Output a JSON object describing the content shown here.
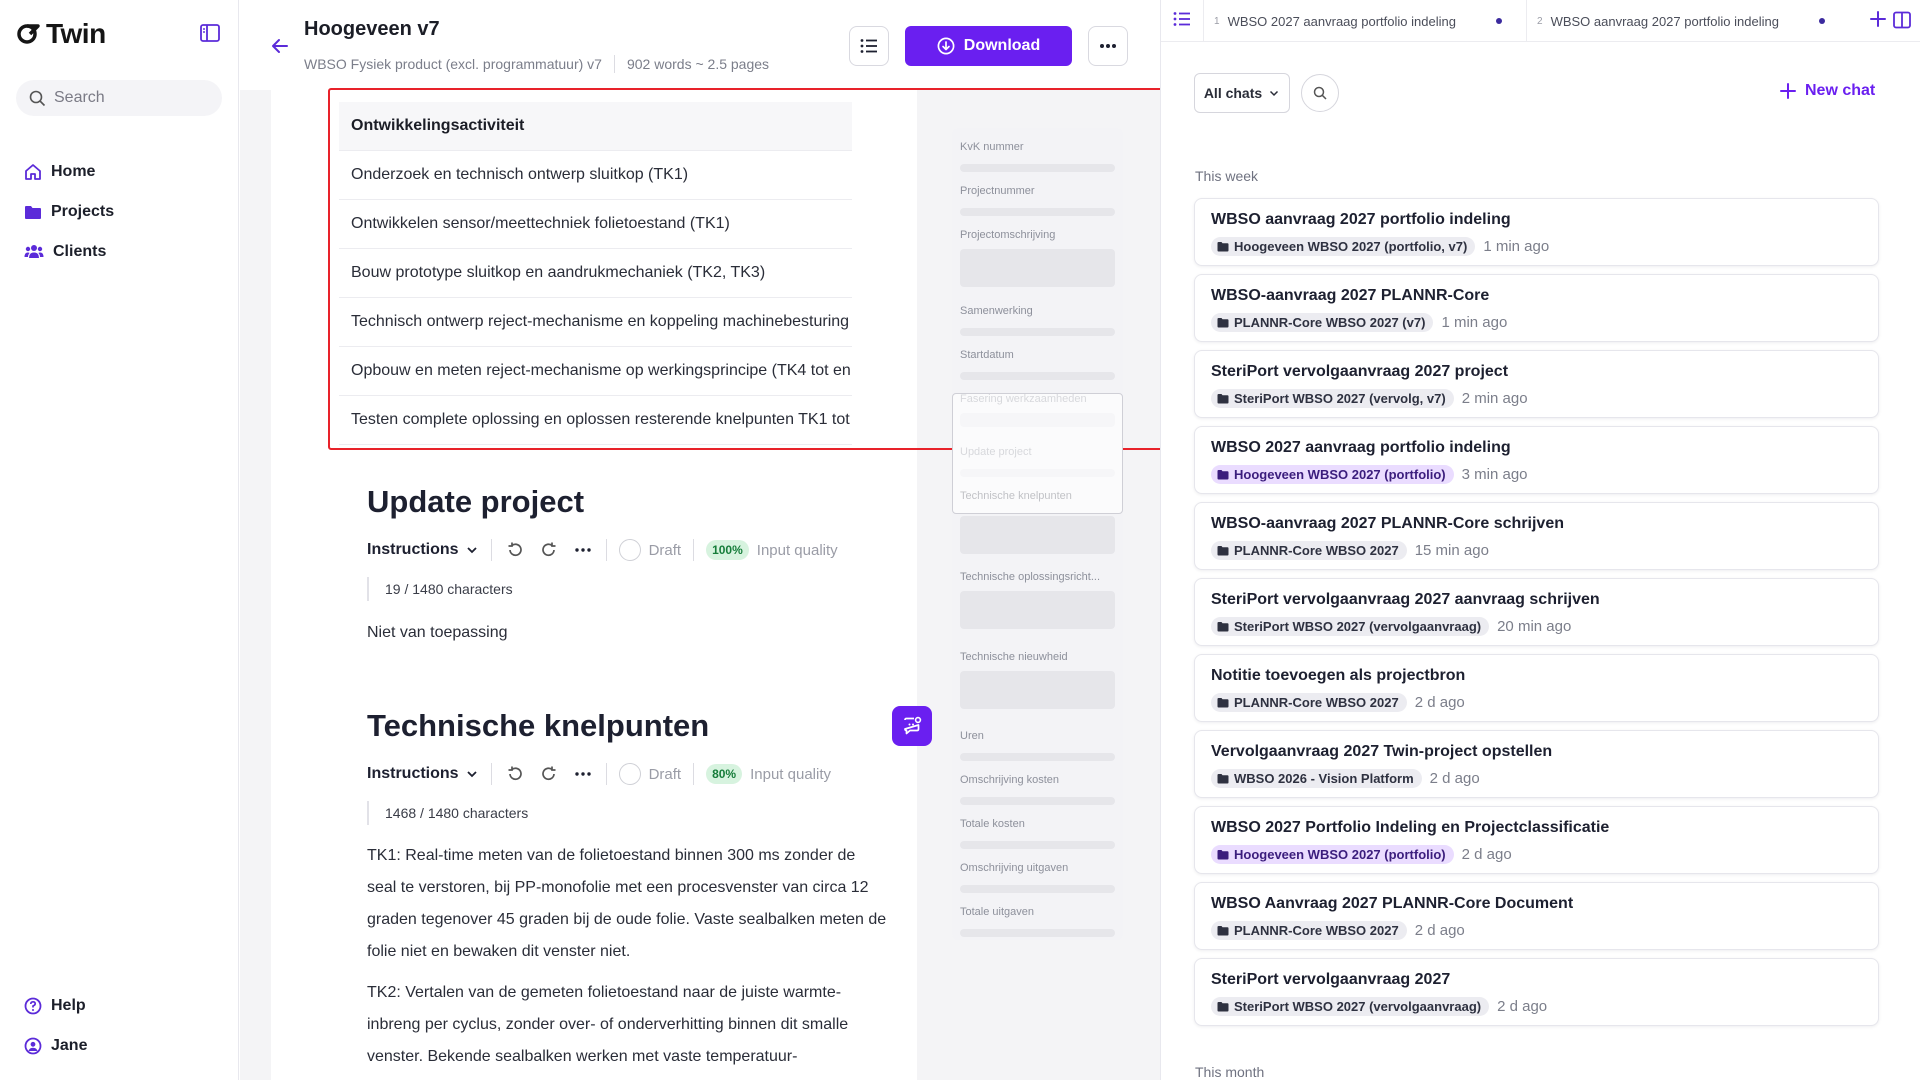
{
  "app": {
    "logo_text": "Twin"
  },
  "sidebar": {
    "search_placeholder": "Search",
    "items": [
      {
        "label": "Home",
        "icon": "home-icon"
      },
      {
        "label": "Projects",
        "icon": "folder-icon"
      },
      {
        "label": "Clients",
        "icon": "users-icon"
      }
    ],
    "bottom": [
      {
        "label": "Help",
        "icon": "help-icon"
      },
      {
        "label": "Jane",
        "icon": "user-icon"
      }
    ]
  },
  "document": {
    "title": "Hoogeveen v7",
    "subtitle": "WBSO Fysiek product (excl. programmatuur) v7",
    "stats": "902 words ~ 2.5 pages",
    "download_label": "Download",
    "activities": {
      "header": "Ontwikkelingsactiviteit",
      "rows": [
        "Onderzoek en technisch ontwerp sluitkop (TK1)",
        "Ontwikkelen sensor/meettechniek folietoestand (TK1)",
        "Bouw prototype sluitkop en aandrukmechaniek (TK2, TK3)",
        "Technisch ontwerp reject-mechanisme en koppeling machinebesturing",
        "Opbouw en meten reject-mechanisme op werkingsprincipe (TK4 tot en",
        "Testen complete oplossing en oplossen resterende knelpunten TK1 tot"
      ]
    },
    "sections": [
      {
        "title": "Update project",
        "instructions_label": "Instructions",
        "status": "Draft",
        "quality_badge": "100%",
        "quality_label": "Input quality",
        "char_count": "19 / 1480 characters",
        "body": "Niet van toepassing"
      },
      {
        "title": "Technische knelpunten",
        "instructions_label": "Instructions",
        "status": "Draft",
        "quality_badge": "80%",
        "quality_label": "Input quality",
        "char_count": "1468 / 1480 characters",
        "body": "TK1: Real-time meten van de folietoestand binnen 300 ms zonder de seal te verstoren, bij PP-monofolie met een procesvenster van circa 12 graden tegenover 45 graden bij de oude folie. Vaste sealbalken meten de folie niet en bewaken dit venster niet.",
        "body2": "TK2: Vertalen van de gemeten folietoestand naar de juiste warmte-inbreng per cyclus, zonder over- of onderverhitting binnen dit smalle venster. Bekende sealbalken werken met vaste temperatuur-"
      }
    ]
  },
  "section_nav": [
    "KvK nummer",
    "Projectnummer",
    "Projectomschrijving",
    "Samenwerking",
    "Startdatum",
    "Fasering werkzaamheden",
    "Update project",
    "Technische knelpunten",
    "Technische oplossingsricht...",
    "Technische nieuwheid",
    "Uren",
    "Omschrijving kosten",
    "Totale kosten",
    "Omschrijving uitgaven",
    "Totale uitgaven"
  ],
  "chat_panel": {
    "tabs": [
      {
        "num": "1",
        "label": "WBSO 2027 aanvraag portfolio indeling"
      },
      {
        "num": "2",
        "label": "WBSO aanvraag 2027 portfolio indeling"
      }
    ],
    "filter_label": "All chats",
    "new_chat_label": "New chat",
    "group_this_week": "This week",
    "group_this_month": "This month",
    "chats": [
      {
        "title": "WBSO aanvraag 2027 portfolio indeling",
        "tag": "Hoogeveen WBSO 2027 (portfolio, v7)",
        "time": "1 min ago",
        "tag_style": "grey"
      },
      {
        "title": "WBSO-aanvraag 2027 PLANNR-Core",
        "tag": "PLANNR-Core WBSO 2027 (v7)",
        "time": "1 min ago",
        "tag_style": "grey"
      },
      {
        "title": "SteriPort vervolgaanvraag 2027 project",
        "tag": "SteriPort WBSO 2027 (vervolg, v7)",
        "time": "2 min ago",
        "tag_style": "grey"
      },
      {
        "title": "WBSO 2027 aanvraag portfolio indeling",
        "tag": "Hoogeveen WBSO 2027 (portfolio)",
        "time": "3 min ago",
        "tag_style": "purple"
      },
      {
        "title": "WBSO-aanvraag 2027 PLANNR-Core schrijven",
        "tag": "PLANNR-Core WBSO 2027",
        "time": "15 min ago",
        "tag_style": "grey"
      },
      {
        "title": "SteriPort vervolgaanvraag 2027 aanvraag schrijven",
        "tag": "SteriPort WBSO 2027 (vervolgaanvraag)",
        "time": "20 min ago",
        "tag_style": "grey"
      },
      {
        "title": "Notitie toevoegen als projectbron",
        "tag": "PLANNR-Core WBSO 2027",
        "time": "2 d ago",
        "tag_style": "grey"
      },
      {
        "title": "Vervolgaanvraag 2027 Twin-project opstellen",
        "tag": "WBSO 2026 - Vision Platform",
        "time": "2 d ago",
        "tag_style": "grey"
      },
      {
        "title": "WBSO 2027 Portfolio Indeling en Projectclassificatie",
        "tag": "Hoogeveen WBSO 2027 (portfolio)",
        "time": "2 d ago",
        "tag_style": "purple"
      },
      {
        "title": "WBSO Aanvraag 2027 PLANNR-Core Document",
        "tag": "PLANNR-Core WBSO 2027",
        "time": "2 d ago",
        "tag_style": "grey"
      },
      {
        "title": "SteriPort vervolgaanvraag 2027",
        "tag": "SteriPort WBSO 2027 (vervolgaanvraag)",
        "time": "2 d ago",
        "tag_style": "grey"
      }
    ]
  },
  "colors": {
    "accent": "#6a1ff0",
    "highlight": "#e8222a",
    "quality_green": "#d7f3df"
  }
}
